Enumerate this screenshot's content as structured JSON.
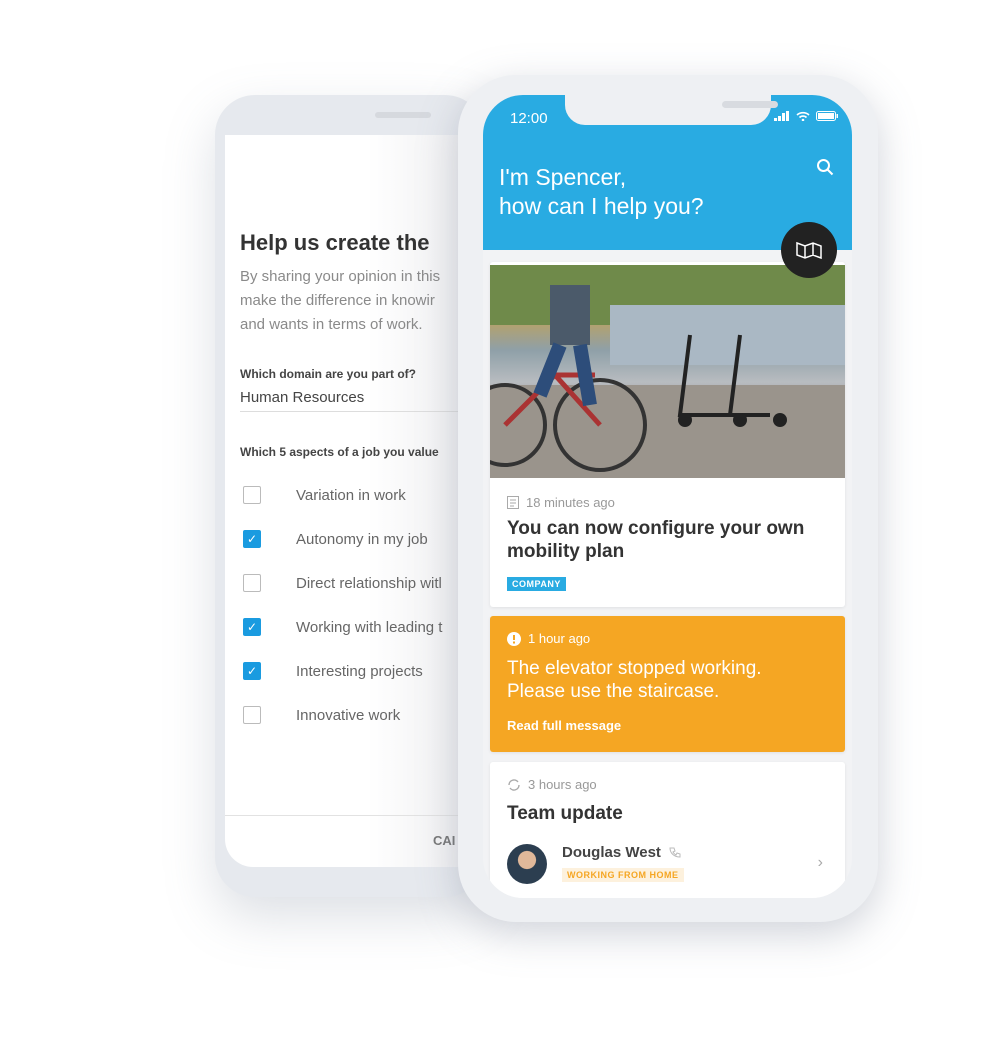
{
  "back_phone": {
    "title": "Help us create the",
    "description": "By sharing your opinion in this\nmake the difference in knowir\nand wants in terms of work.",
    "domain_question": "Which domain are you part of?",
    "domain_value": "Human Resources",
    "aspects_question": "Which 5 aspects of a job you value",
    "options": [
      {
        "label": "Variation in work",
        "checked": false
      },
      {
        "label": "Autonomy in my job",
        "checked": true
      },
      {
        "label": "Direct relationship witl",
        "checked": false
      },
      {
        "label": "Working with leading t",
        "checked": true
      },
      {
        "label": "Interesting projects",
        "checked": true
      },
      {
        "label": "Innovative work",
        "checked": false
      }
    ],
    "cancel_label": "CAI"
  },
  "front_phone": {
    "status_time": "12:00",
    "greeting": "I'm Spencer,\nhow can I help you?",
    "accent_color": "#29abe2",
    "alert_color": "#f5a623",
    "cards": [
      {
        "meta": "18 minutes ago",
        "icon": "document-icon",
        "title": "You can now configure your own\nmobility plan",
        "badge": "COMPANY"
      },
      {
        "meta": "1 hour ago",
        "icon": "alert-icon",
        "title": "The elevator stopped working.\nPlease use the staircase.",
        "link": "Read full message"
      },
      {
        "meta": "3 hours ago",
        "icon": "sync-icon",
        "title": "Team update",
        "person": {
          "name": "Douglas West",
          "status": "WORKING FROM HOME"
        }
      }
    ]
  }
}
